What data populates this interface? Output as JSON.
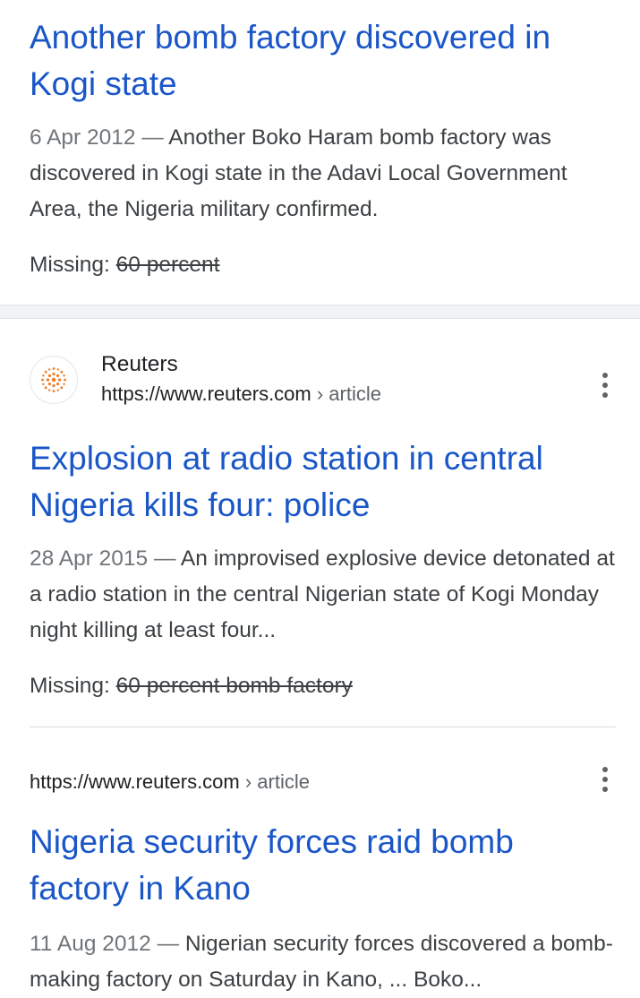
{
  "results": [
    {
      "title": "Another bomb factory discovered in Kogi state",
      "date": "6 Apr 2012",
      "separator": " — ",
      "snippet": "Another Boko Haram bomb factory was discovered in Kogi state in the Adavi Local Government Area, the Nigeria military confirmed.",
      "missing_label": "Missing: ",
      "missing_terms": "60 percent"
    },
    {
      "site_name": "Reuters",
      "url": "https://www.reuters.com",
      "breadcrumb": " › article",
      "favicon": "reuters-logo",
      "title": "Explosion at radio station in central Nigeria kills four: police",
      "date": "28 Apr 2015",
      "separator": " — ",
      "snippet": "An improvised explosive device detonated at a radio station in the central Nigerian state of Kogi Monday night killing at least four...",
      "missing_label": "Missing: ",
      "missing_terms": "60 percent bomb factory"
    },
    {
      "url": "https://www.reuters.com",
      "breadcrumb": " › article",
      "title": "Nigeria security forces raid bomb factory in Kano",
      "date": "11 Aug 2012",
      "separator": " — ",
      "snippet": "Nigerian security forces discovered a bomb-making factory on Saturday in Kano, ... Boko..."
    }
  ],
  "colors": {
    "title_link": "#1a56c7",
    "snippet_text": "#3c4043",
    "date_text": "#70757a",
    "favicon_accent": "#f07b23"
  }
}
